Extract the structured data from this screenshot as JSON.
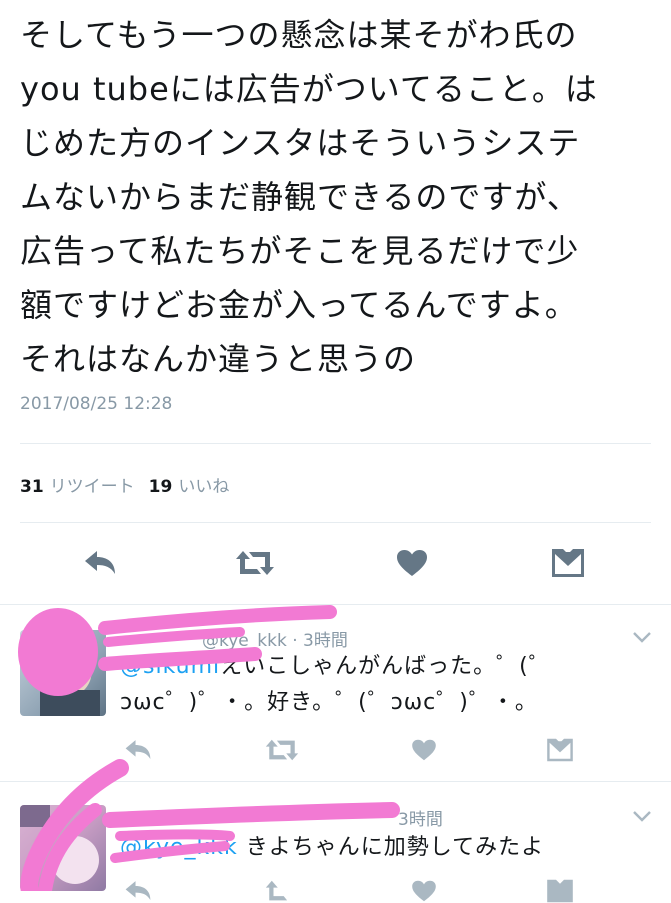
{
  "tweet": {
    "lines": [
      "そしてもう一つの懸念は某そがわ氏の",
      "you tubeには広告がついてること。は",
      "じめた方のインスタはそういうシステ",
      "ムないからまだ静観できるのですが、",
      "広告って私たちがそこを見るだけで少",
      "額ですけどお金が入ってるんですよ。",
      "それはなんか違うと思うの"
    ],
    "timestamp": "2017/08/25 12:28",
    "retweets_count": "31",
    "retweets_label": "リツイート",
    "likes_count": "19",
    "likes_label": "いいね"
  },
  "replies": [
    {
      "handle": "@kye_kkk",
      "time": "3時間",
      "mention": "@sikumi",
      "line1": "えいこしゃんがんばった。゜(゜",
      "line2": "ↄωc゜)゜・。好き。゜(゜ↄωc゜)゜・。"
    },
    {
      "time": "3時間",
      "mention": "@kye_kkk",
      "text": "きよちゃんに加勢してみたよ"
    }
  ],
  "icons": [
    "reply-icon",
    "retweet-icon",
    "like-icon",
    "dm-icon",
    "chevron-down-icon"
  ],
  "colors": {
    "text": "#14171a",
    "muted": "#8899a6",
    "accent": "#1da1f2",
    "icon": "#657786",
    "icon_light": "#aab8c2",
    "scribble": "#f27ad3"
  }
}
